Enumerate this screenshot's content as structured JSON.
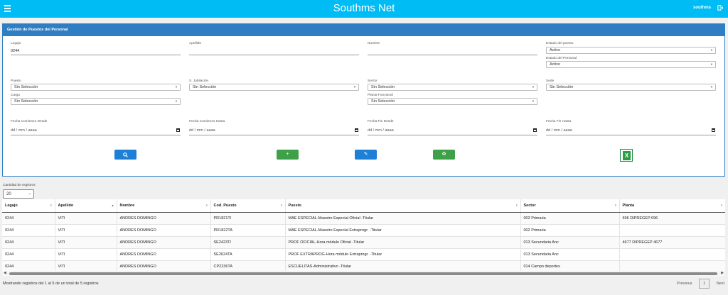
{
  "header": {
    "title": "Southms Net",
    "user": "southms"
  },
  "panel": {
    "title": "Gestión de Puestos del Personal",
    "legajo": {
      "label": "Legajo",
      "value": "0244"
    },
    "apellido": {
      "label": "Apellido",
      "value": ""
    },
    "nombre": {
      "label": "Nombre",
      "value": ""
    },
    "estado_puesto": {
      "label": "Estado del puesto",
      "value": "Activo"
    },
    "estado_personal": {
      "label": "Estado del Personal",
      "value": "Activo"
    },
    "puesto": {
      "label": "Puesto",
      "value": "Sin Selección"
    },
    "jubilacion": {
      "label": "S. Jubilación",
      "value": "Sin Selección"
    },
    "sector": {
      "label": "Sector",
      "value": "Sin Selección"
    },
    "sede": {
      "label": "Sede",
      "value": "Sin Selección"
    },
    "cargo": {
      "label": "Cargo",
      "value": "Sin Selección"
    },
    "planta": {
      "label": "Planta Funcional",
      "value": "Sin Selección"
    },
    "fecha_com_desde": {
      "label": "Fecha Comienzo Desde",
      "placeholder": "dd / mm / aaaa"
    },
    "fecha_com_hasta": {
      "label": "Fecha Comienzo Hasta",
      "placeholder": "dd / mm / aaaa"
    },
    "fecha_fin_desde": {
      "label": "Fecha Fin Desde",
      "placeholder": "dd / mm / aaaa"
    },
    "fecha_fin_hasta": {
      "label": "Fecha Fin Hasta",
      "placeholder": "dd / mm / aaaa"
    },
    "buttons": {
      "search": "🔍",
      "add": "+",
      "edit": "✎",
      "recycle": "♻",
      "excel": "X"
    }
  },
  "table": {
    "length_label": "Cantidad de registros",
    "length_value": "20",
    "columns": [
      "Legajo",
      "Apellido",
      "Nombre",
      "Cod. Puesto",
      "Puesto",
      "Sector",
      "Planta"
    ],
    "rows": [
      [
        "0244",
        "VITI",
        "ANDRES DOMINGO",
        "PR1821TI",
        "MAE ESPECIAL-Maestro Especial Oficial -Titular",
        "002 Primaria",
        "696 DIPREGEP 696"
      ],
      [
        "0244",
        "VITI",
        "ANDRES DOMINGO",
        "PR1822TA",
        "MAE ESPECIAL-Maestro Especial Extraprogr. -Titular",
        "002 Primaria",
        ""
      ],
      [
        "0244",
        "VITI",
        "ANDRES DOMINGO",
        "SE2423TI",
        "PROF OFICIAL-Hora módulo Oficial -Titular",
        "013 Secundaria Anc",
        "4677 DIPREGEP 4677"
      ],
      [
        "0244",
        "VITI",
        "ANDRES DOMINGO",
        "SE2624TA",
        "PROF EXTRAPROG-Hora módulo Extraprogr. -Titular",
        "013 Secundaria Anc",
        ""
      ],
      [
        "0244",
        "VITI",
        "ANDRES DOMINGO",
        "CP2236TA",
        "ESCUELITAS-Administrativo -Titular",
        "014 Campo deportes",
        ""
      ]
    ],
    "info": "Mostrando registros del 1 al 5 de un total de 5 registros",
    "pager": {
      "previous": "Previous",
      "current": "1",
      "next": "Next"
    }
  }
}
